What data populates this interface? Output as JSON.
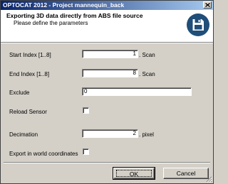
{
  "window": {
    "title": "OPTOCAT 2012 - Project mannequin_back"
  },
  "header": {
    "title": "Exporting 3D data directly from ABS file source",
    "subtitle": "Please define the parameters",
    "icon": "floppy-disk-save-icon"
  },
  "form": {
    "start_index": {
      "label": "Start Index [1..8]",
      "value": "1",
      "unit": ". Scan"
    },
    "end_index": {
      "label": "End Index [1..8]",
      "value": "8",
      "unit": ". Scan"
    },
    "exclude": {
      "label": "Exclude",
      "value": "0"
    },
    "reload_sensor": {
      "label": "Reload Sensor",
      "checked": false
    },
    "decimation": {
      "label": "Decimation",
      "value": "2",
      "unit": ". pixel"
    },
    "export_world": {
      "label": "Export in world coordinates",
      "checked": false
    }
  },
  "buttons": {
    "ok_label": "OK",
    "cancel_label": "Cancel"
  },
  "colors": {
    "titlebar_start": "#0a246a",
    "titlebar_end": "#a6caf0",
    "dialog_bg": "#d4d0c8",
    "icon_blue": "#1f4e79"
  }
}
